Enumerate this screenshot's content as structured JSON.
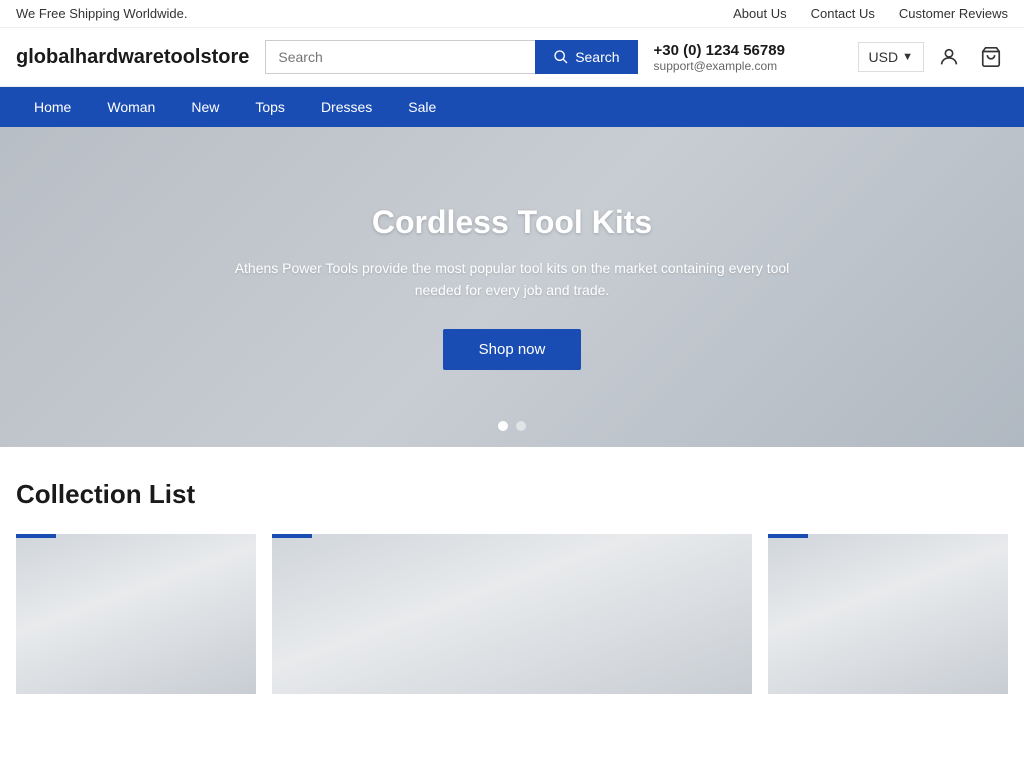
{
  "announcement": {
    "text": "We Free Shipping Worldwide."
  },
  "top_links": [
    {
      "label": "About Us",
      "name": "about-us-link"
    },
    {
      "label": "Contact Us",
      "name": "contact-us-link"
    },
    {
      "label": "Customer Reviews",
      "name": "customer-reviews-link"
    }
  ],
  "header": {
    "logo": "globalhardwaretoolstore",
    "search_placeholder": "Search",
    "search_button_label": "Search",
    "phone": "+30 (0) 1234 56789",
    "email": "support@example.com",
    "currency": "USD"
  },
  "nav": {
    "items": [
      {
        "label": "Home"
      },
      {
        "label": "Woman"
      },
      {
        "label": "New"
      },
      {
        "label": "Tops"
      },
      {
        "label": "Dresses"
      },
      {
        "label": "Sale"
      }
    ]
  },
  "hero": {
    "title": "Cordless Tool Kits",
    "description": "Athens Power Tools provide the most popular tool kits on the market containing every tool needed for every job and trade.",
    "cta_label": "Shop now",
    "dots": [
      true,
      false
    ]
  },
  "collection": {
    "title": "Collection List",
    "cards": [
      {
        "name": "card-1"
      },
      {
        "name": "card-2"
      },
      {
        "name": "card-3"
      }
    ]
  }
}
